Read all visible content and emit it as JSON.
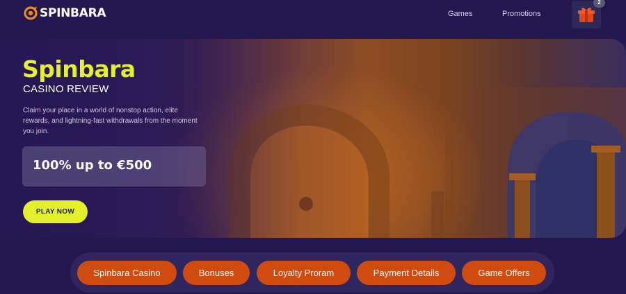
{
  "header": {
    "logo_text": "SPINBARA",
    "nav": [
      {
        "label": "Games"
      },
      {
        "label": "Promotions"
      }
    ],
    "gift_badge": "2"
  },
  "hero": {
    "title": "Spinbara",
    "subtitle": "CASINO REVIEW",
    "description": "Claim your place in a world of nonstop action, elite rewards, and lightning-fast withdrawals from the moment you join.",
    "bonus": "100% up to €500",
    "cta_label": "PLAY NOW"
  },
  "tabs": [
    {
      "label": "Spinbara Casino"
    },
    {
      "label": "Bonuses"
    },
    {
      "label": "Loyalty Proram"
    },
    {
      "label": "Payment Details"
    },
    {
      "label": "Game Offers"
    }
  ],
  "colors": {
    "background": "#22174e",
    "accent_yellow": "#e4f02b",
    "tab_orange": "#cf4b10",
    "logo_orange": "#f08a1c"
  }
}
